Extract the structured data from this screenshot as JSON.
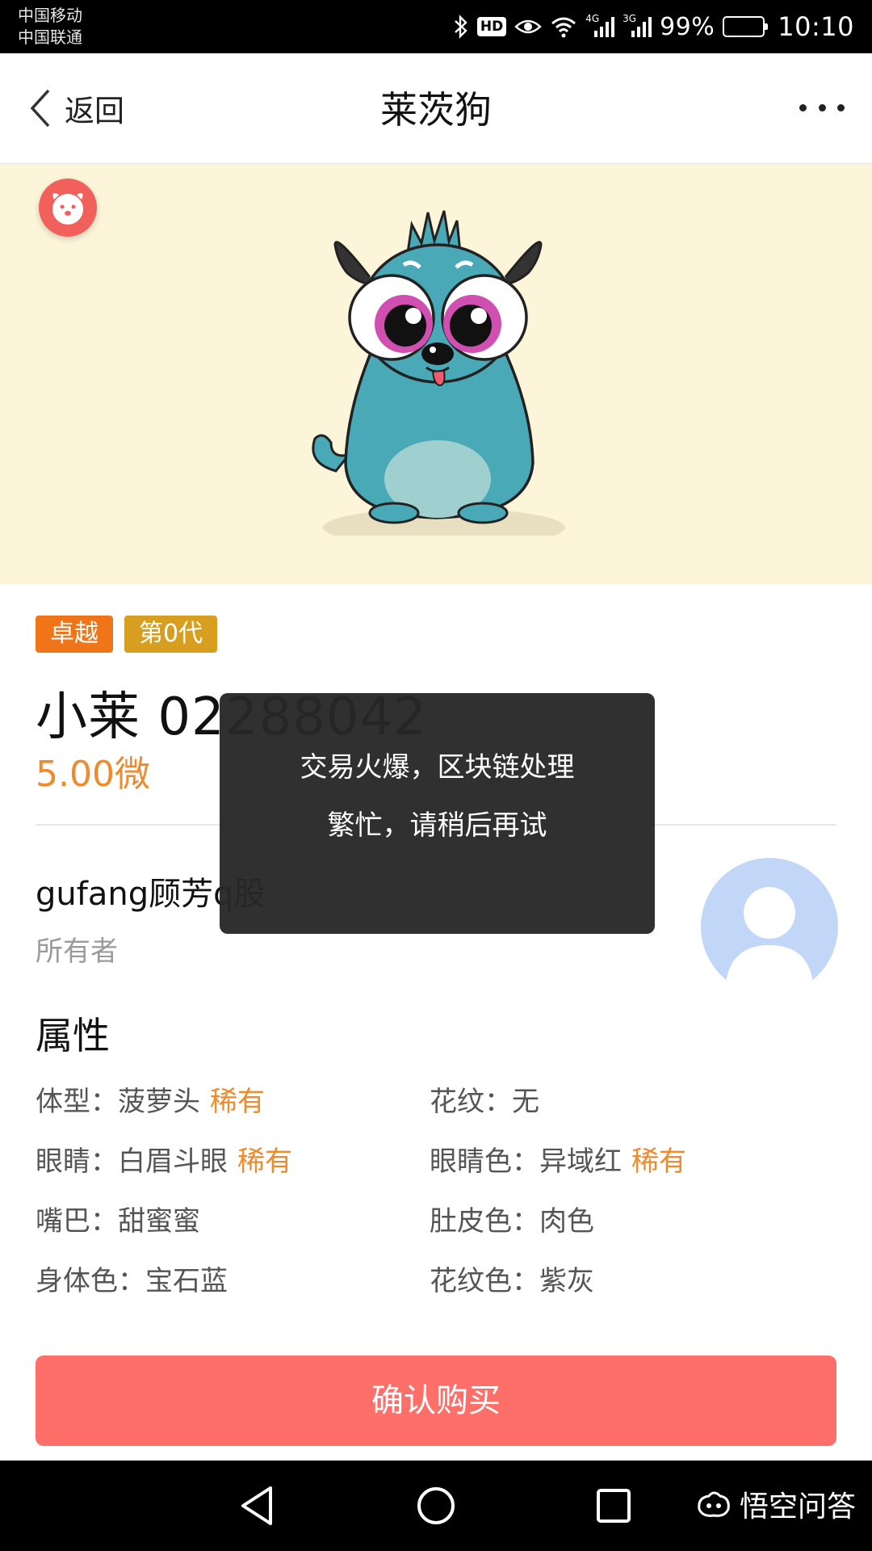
{
  "status_bar": {
    "carrier_1": "中国移动",
    "carrier_2": "中国联通",
    "hd": "HD",
    "net_1": "4G",
    "net_2": "3G",
    "battery": "99%",
    "time": "10:10"
  },
  "nav": {
    "back_label": "返回",
    "title": "莱茨狗"
  },
  "pet": {
    "tags": [
      "卓越",
      "第0代"
    ],
    "name": "小莱 02288042",
    "price": "5.00微"
  },
  "owner": {
    "name": "gufang顾芳q股",
    "label": "所有者"
  },
  "attributes": {
    "title": "属性",
    "items": [
      {
        "label": "体型：",
        "value": "菠萝头",
        "rare": "稀有"
      },
      {
        "label": "花纹：",
        "value": "无",
        "rare": ""
      },
      {
        "label": "眼睛：",
        "value": "白眉斗眼",
        "rare": "稀有"
      },
      {
        "label": "眼睛色：",
        "value": "异域红",
        "rare": "稀有"
      },
      {
        "label": "嘴巴：",
        "value": "甜蜜蜜",
        "rare": ""
      },
      {
        "label": "肚皮色：",
        "value": "肉色",
        "rare": ""
      },
      {
        "label": "身体色：",
        "value": "宝石蓝",
        "rare": ""
      },
      {
        "label": "花纹色：",
        "value": "紫灰",
        "rare": ""
      }
    ]
  },
  "buy_button": "确认购买",
  "toast": {
    "line_1": "交易火爆，区块链处理",
    "line_2": "繁忙，请稍后再试"
  },
  "watermark": "悟空问答",
  "colors": {
    "accent_orange": "#ef8a2d",
    "buy_button": "#ff6f6a",
    "hero_bg": "#fdf5d9",
    "dog_body": "#49a9b6"
  }
}
